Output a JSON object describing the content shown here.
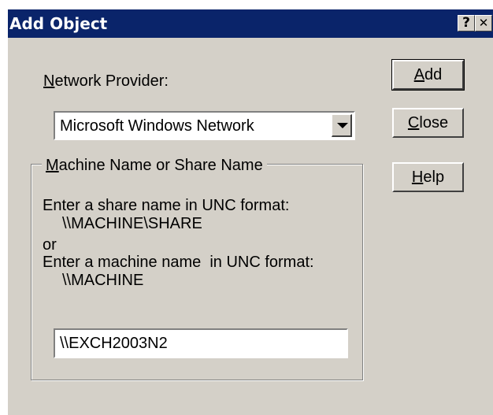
{
  "window": {
    "title": "Add Object",
    "help_glyph": "?",
    "close_glyph": "✕"
  },
  "form": {
    "network_provider_label_accel": "N",
    "network_provider_label_rest": "etwork Provider:",
    "network_provider_value": "Microsoft Windows Network",
    "group_title_accel": "M",
    "group_title_rest": "achine Name or Share Name",
    "instr_line1": "Enter a share name in UNC format:",
    "instr_line2": "\\\\MACHINE\\SHARE",
    "instr_line3": "or",
    "instr_line4": "Enter a machine name  in UNC format:",
    "instr_line5": "\\\\MACHINE",
    "unc_input_value": "\\\\EXCH2003N2"
  },
  "buttons": {
    "add_accel": "A",
    "add_rest": "dd",
    "close_accel": "C",
    "close_rest": "lose",
    "help_accel": "H",
    "help_rest": "elp"
  },
  "colors": {
    "titlebar": "#0a246a",
    "face": "#d4d0c8"
  }
}
